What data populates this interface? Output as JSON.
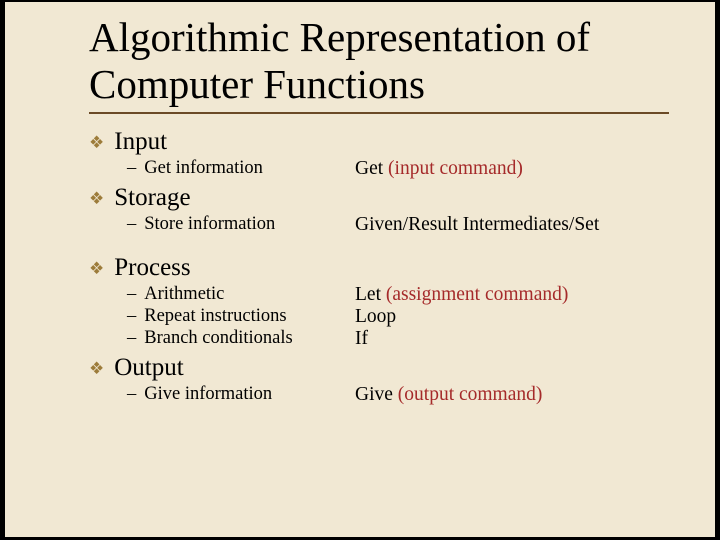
{
  "title": "Algorithmic Representation of Computer Functions",
  "sections": [
    {
      "heading": "Input",
      "items": [
        {
          "label": "Get information",
          "rhs_plain": "Get ",
          "rhs_brown": "(input command)"
        }
      ]
    },
    {
      "heading": "Storage",
      "items": [
        {
          "label": "Store information",
          "rhs_plain": "Given/Result Intermediates/Set",
          "rhs_brown": ""
        }
      ]
    },
    {
      "heading": "Process",
      "items": [
        {
          "label": "Arithmetic",
          "rhs_plain": "Let   ",
          "rhs_brown": "(assignment command)"
        },
        {
          "label": "Repeat instructions",
          "rhs_plain": "Loop",
          "rhs_brown": ""
        },
        {
          "label": "Branch conditionals",
          "rhs_plain": "If",
          "rhs_brown": ""
        }
      ]
    },
    {
      "heading": "Output",
      "items": [
        {
          "label": "Give information",
          "rhs_plain": "Give  ",
          "rhs_brown": "(output command)"
        }
      ]
    }
  ]
}
